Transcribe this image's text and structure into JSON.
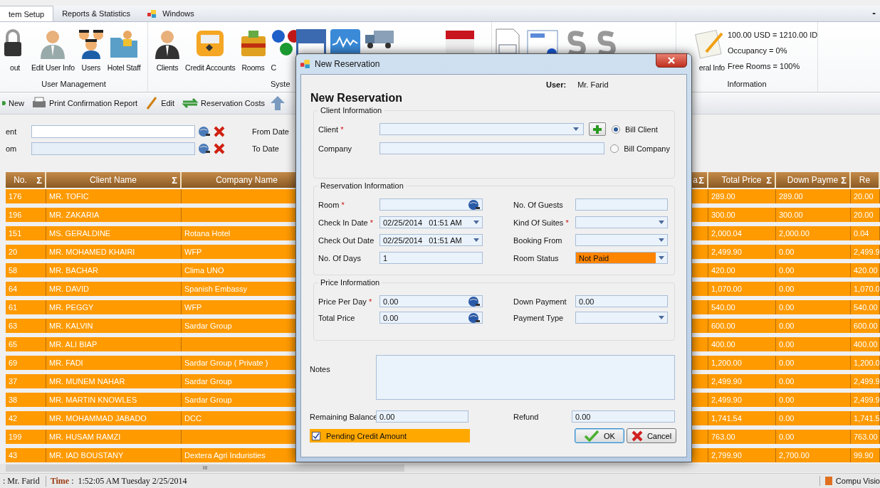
{
  "tabs": [
    {
      "label": "tem Setup",
      "selected": true
    },
    {
      "label": "Reports & Statistics",
      "selected": false
    },
    {
      "label": "Windows",
      "selected": false
    }
  ],
  "minimize": "-",
  "ribbon": {
    "groups": [
      {
        "label": "User Management",
        "items": [
          "out",
          "Edit User Info",
          "Users",
          "Hotel Staff"
        ]
      },
      {
        "label": "Syste",
        "items": [
          "Clients",
          "Credit Accounts",
          "Rooms",
          "C"
        ]
      }
    ],
    "information": {
      "item": "eral Info",
      "lines": [
        "100.00 USD = 1210.00 ID",
        "Occupancy = 0%",
        "Free Rooms = 100%"
      ],
      "label": "Information"
    }
  },
  "toolbar": [
    "New",
    "Print Confirmation Report",
    "Edit",
    "Reservation Costs"
  ],
  "filters": [
    {
      "label": "ent",
      "date_label": "From Date"
    },
    {
      "label": "om",
      "date_label": "To Date"
    }
  ],
  "table": {
    "columns": [
      {
        "label": "No.",
        "sum": "Σ"
      },
      {
        "label": "Client Name",
        "sum": "Σ"
      },
      {
        "label": "Company Name"
      },
      {
        "label": "a",
        "sum": "Σ"
      },
      {
        "label": "Total Price",
        "sum": "Σ"
      },
      {
        "label": "Down Payme",
        "sum": "Σ"
      },
      {
        "label": "Re"
      }
    ],
    "rows": [
      {
        "no": "176",
        "client": "MR. TOFIC",
        "total": "289.00",
        "down": "289.00",
        "column_8": "20.00"
      },
      {
        "no": "196",
        "client": "MR. ZAKARIA",
        "total": "300.00",
        "down": "300.00",
        "column_8": "20.00"
      },
      {
        "no": "151",
        "client": "MS. GERALDINE",
        "company": "Rotana Hotel",
        "total": "2,000.04",
        "down": "2,000.00",
        "column_8": "0.04"
      },
      {
        "no": "20",
        "client": "MR. MOHAMED KHAIRI",
        "company": "WFP",
        "total": "2,499.90",
        "down": "0.00",
        "column_8": "2,499.9"
      },
      {
        "no": "58",
        "client": "MR. BACHAR",
        "company": "Clima UNO",
        "total": "420.00",
        "down": "0.00",
        "column_8": "420.00"
      },
      {
        "no": "64",
        "client": "MR. DAVID",
        "company": "Spanish Embassy",
        "total": "1,070.00",
        "down": "0.00",
        "column_8": "1,070.0"
      },
      {
        "no": "61",
        "client": "MR. PEGGY",
        "company": "WFP",
        "total": "540.00",
        "down": "0.00",
        "column_8": "540.00"
      },
      {
        "no": "63",
        "client": "MR. KALVIN",
        "company": "Sardar Group",
        "total": "600.00",
        "down": "0.00",
        "column_8": "600.00"
      },
      {
        "no": "65",
        "client": "MR. ALI BIAP",
        "total": "400.00",
        "down": "0.00",
        "column_8": "400.00"
      },
      {
        "no": "69",
        "client": "MR. FADI",
        "company": "Sardar Group ( Private )",
        "total": "1,200.00",
        "down": "0.00",
        "column_8": "1,200.0"
      },
      {
        "no": "37",
        "client": "MR. MUNEM NAHAR",
        "company": "Sardar Group",
        "total": "2,499.90",
        "down": "0.00",
        "column_8": "2,499.9"
      },
      {
        "no": "38",
        "client": "MR. MARTIN KNOWLES",
        "company": "Sardar Group",
        "total": "2,499.90",
        "down": "0.00",
        "column_8": "2,499.9"
      },
      {
        "no": "42",
        "client": "MR. MOHAMMAD JABADO",
        "company": "DCC",
        "total": "1,741.54",
        "down": "0.00",
        "column_8": "1,741.5"
      },
      {
        "no": "199",
        "client": "MR. HUSAM RAMZI",
        "total": "763.00",
        "down": "0.00",
        "column_8": "763.00"
      },
      {
        "no": "43",
        "client": "MR. IAD BOUSTANY",
        "company": "Dextera Agri Induristies",
        "total": "2,799.90",
        "down": "2,700.00",
        "column_8": "99.90"
      }
    ]
  },
  "scroll_grip": "III",
  "status_bar": {
    "user": ": Mr. Farid",
    "time_label": "Time",
    "time_sep": ":",
    "time": "1:52:05 AM Tuesday 2/25/2014",
    "brand": "Compu Visio"
  },
  "dialog": {
    "title": "New Reservation",
    "user_label": "User:",
    "user": "Mr. Farid",
    "heading": "New Reservation",
    "client_group": {
      "legend": "Client Information",
      "client": {
        "label": "Client",
        "mark": "*"
      },
      "company": {
        "label": "Company"
      },
      "bill_options": [
        {
          "label": "Bill Client",
          "selected": true
        },
        {
          "label": "Bill Company",
          "selected": false
        }
      ]
    },
    "reservation_group": {
      "legend": "Reservation Information",
      "left": [
        {
          "label": "Room",
          "mark": "*",
          "kind": "lookup"
        },
        {
          "label": "Check In Date",
          "mark": "*",
          "kind": "date",
          "value": "02/25/2014   01:51 AM"
        },
        {
          "label": "Check Out Date",
          "kind": "date",
          "value": "02/25/2014   01:51 AM"
        },
        {
          "label": "No. Of Days",
          "kind": "text",
          "value": "1"
        }
      ],
      "right": [
        {
          "label": "No. Of Guests",
          "kind": "text"
        },
        {
          "label": "Kind Of Suites",
          "mark": "*",
          "kind": "combo"
        },
        {
          "label": "Booking From",
          "kind": "combo"
        },
        {
          "label": "Room Status",
          "kind": "status",
          "value": "Not Paid"
        }
      ]
    },
    "price_group": {
      "legend": "Price Information",
      "left": [
        {
          "label": "Price Per Day",
          "mark": "*",
          "kind": "lookup",
          "value": "0.00"
        },
        {
          "label": "Total Price",
          "kind": "lookup",
          "value": "0.00"
        }
      ],
      "right": [
        {
          "label": "Down Payment",
          "kind": "text",
          "value": "0.00"
        },
        {
          "label": "Payment Type",
          "kind": "combo"
        }
      ]
    },
    "notes_label": "Notes",
    "remaining": {
      "label": "Remaining Balance",
      "value": "0.00"
    },
    "refund": {
      "label": "Refund",
      "value": "0.00"
    },
    "pending": {
      "label": "Pending Credit Amount",
      "checked": true
    },
    "buttons": [
      "OK",
      "Cancel"
    ]
  }
}
